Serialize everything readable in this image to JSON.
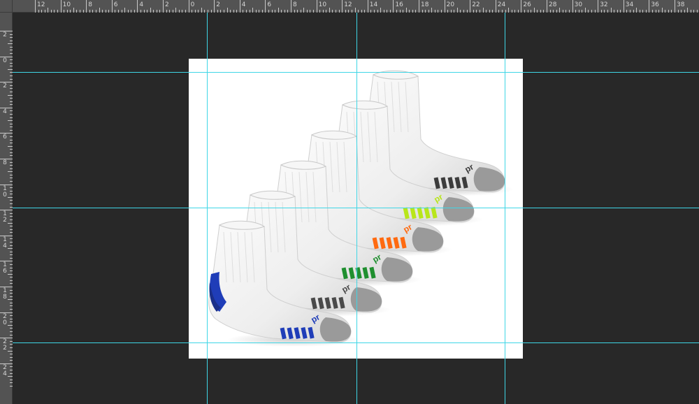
{
  "ruler_top": {
    "labels": [
      "12",
      "10",
      "8",
      "6",
      "4",
      "2",
      "0",
      "2",
      "4",
      "6",
      "8",
      "10",
      "12",
      "14",
      "16",
      "18",
      "20",
      "22",
      "24",
      "26",
      "28",
      "30",
      "32",
      "34",
      "36",
      "38"
    ]
  },
  "ruler_left": {
    "labels": [
      "2",
      "0",
      "2",
      "4",
      "6",
      "8",
      "10",
      "12",
      "14",
      "16",
      "18",
      "20",
      "22",
      "24"
    ]
  },
  "canvas": {
    "content": "six white ankle socks product photo",
    "sock_accent_colors": [
      "#1f3db8",
      "#4a4a4a",
      "#1f8f2f",
      "#ff6a10",
      "#b8e61a",
      "#3c3c3c"
    ],
    "heel_toe_color": "#9a9a9a",
    "sock_color": "#eeeeee",
    "brand_text": "pr"
  },
  "guides": {
    "color": "#3fd6e6",
    "vertical_count": 4,
    "horizontal_count": 3
  }
}
